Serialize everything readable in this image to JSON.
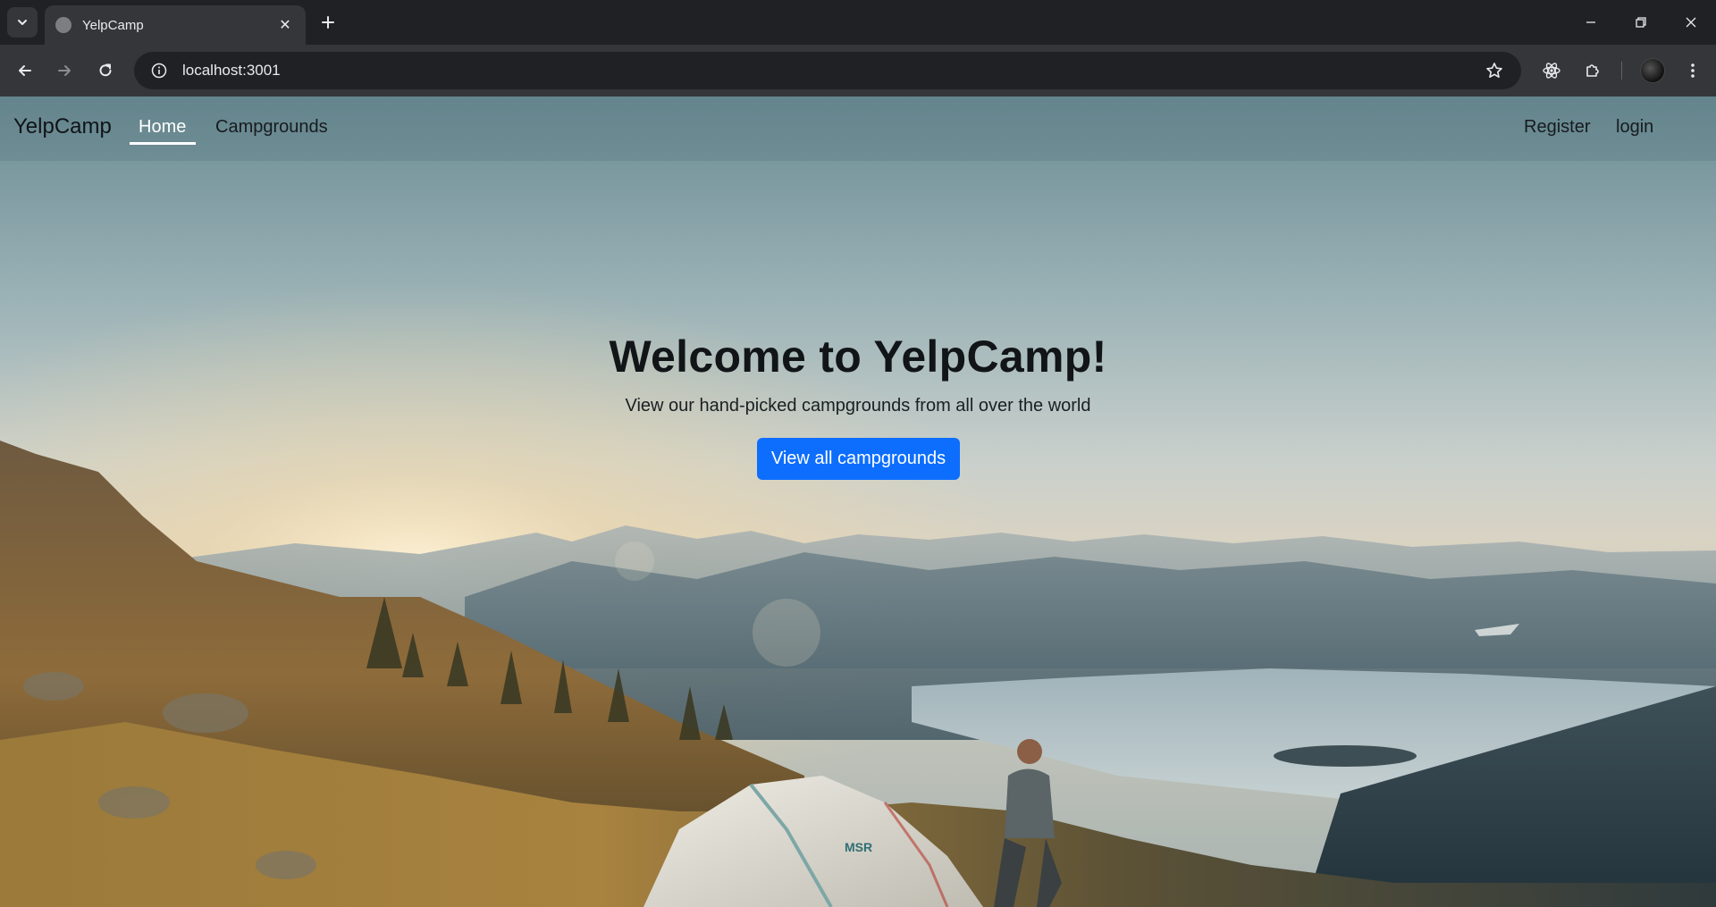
{
  "browser": {
    "tab_title": "YelpCamp",
    "url": "localhost:3001"
  },
  "site": {
    "brand": "YelpCamp",
    "nav": {
      "home": "Home",
      "campgrounds": "Campgrounds",
      "register": "Register",
      "login": "login"
    },
    "hero": {
      "title": "Welcome to YelpCamp!",
      "subtitle": "View our hand-picked campgrounds from all over the world",
      "cta": "View all campgrounds"
    }
  },
  "colors": {
    "button_primary": "#0d6efd",
    "chrome_dark": "#202124",
    "chrome_toolbar": "#35363a"
  }
}
